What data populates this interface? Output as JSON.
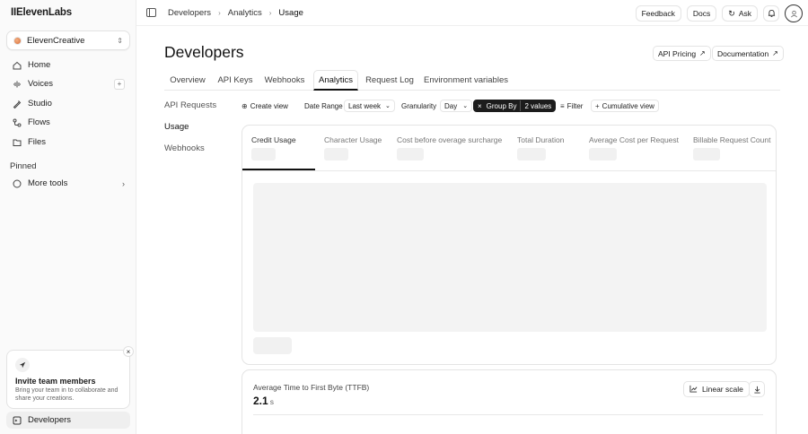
{
  "app": {
    "logo": "IIElevenLabs"
  },
  "workspace": {
    "name": "ElevenCreative"
  },
  "sidebar": {
    "items": [
      {
        "label": "Home",
        "icon": "home-icon"
      },
      {
        "label": "Voices",
        "icon": "voices-icon"
      },
      {
        "label": "Studio",
        "icon": "studio-icon"
      },
      {
        "label": "Flows",
        "icon": "flows-icon"
      },
      {
        "label": "Files",
        "icon": "files-icon"
      }
    ],
    "pinned_label": "Pinned",
    "more_tools": "More tools",
    "invite": {
      "title": "Invite team members",
      "body": "Bring your team in to collaborate and share your creations."
    },
    "developers": "Developers"
  },
  "breadcrumb": [
    "Developers",
    "Analytics",
    "Usage"
  ],
  "topbar": {
    "feedback": "Feedback",
    "docs": "Docs",
    "ask": "Ask"
  },
  "page": {
    "title": "Developers",
    "api_pricing": "API Pricing",
    "documentation": "Documentation"
  },
  "tabs": [
    {
      "label": "Overview"
    },
    {
      "label": "API Keys"
    },
    {
      "label": "Webhooks"
    },
    {
      "label": "Analytics"
    },
    {
      "label": "Request Log"
    },
    {
      "label": "Environment variables"
    }
  ],
  "subnav": [
    "API Requests",
    "Usage",
    "Webhooks"
  ],
  "toolbar": {
    "create_view": "Create view",
    "date_range_label": "Date Range",
    "date_range_value": "Last week",
    "granularity_label": "Granularity",
    "granularity_value": "Day",
    "group_by_label": "Group By",
    "group_by_value": "2 values",
    "filter": "Filter",
    "cumulative": "Cumulative view"
  },
  "metrics": [
    {
      "label": "Credit Usage"
    },
    {
      "label": "Character Usage"
    },
    {
      "label": "Cost before overage surcharge"
    },
    {
      "label": "Total Duration"
    },
    {
      "label": "Average Cost per Request"
    },
    {
      "label": "Billable Request Count"
    }
  ],
  "ttfb": {
    "label": "Average Time to First Byte (TTFB)",
    "value": "2.1",
    "unit": "s",
    "scale": "Linear scale"
  }
}
